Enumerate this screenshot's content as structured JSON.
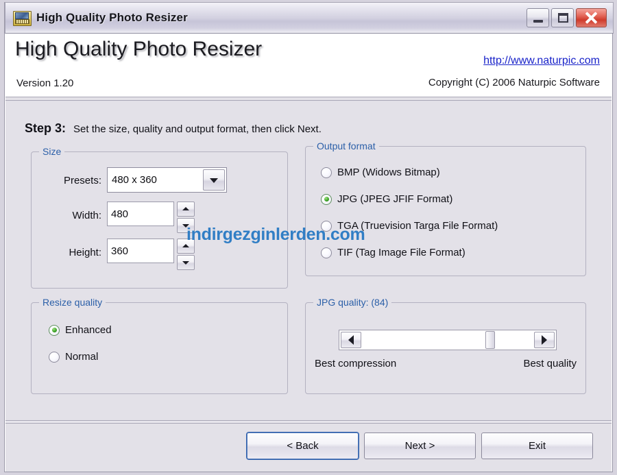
{
  "window": {
    "title": "High Quality Photo Resizer",
    "icon": "photo-resizer-icon",
    "buttons": {
      "minimize": "Minimize",
      "maximize": "Maximize",
      "close": "Close"
    }
  },
  "header": {
    "product_title": "High Quality Photo Resizer",
    "version": "Version 1.20",
    "link": "http://www.naturpic.com",
    "copyright": "Copyright (C) 2006 Naturpic Software"
  },
  "step": {
    "label": "Step 3:",
    "text": "Set the size, quality and output format, then click Next."
  },
  "size": {
    "legend": "Size",
    "presets_label": "Presets:",
    "presets_value": "480 x 360",
    "width_label": "Width:",
    "width_value": "480",
    "height_label": "Height:",
    "height_value": "360"
  },
  "output_format": {
    "legend": "Output format",
    "options": [
      {
        "label": "BMP (Widows Bitmap)",
        "checked": false
      },
      {
        "label": "JPG (JPEG JFIF Format)",
        "checked": true
      },
      {
        "label": "TGA (Truevision Targa File Format)",
        "checked": false
      },
      {
        "label": "TIF (Tag Image File Format)",
        "checked": false
      }
    ]
  },
  "resize_quality": {
    "legend": "Resize quality",
    "options": [
      {
        "label": "Enhanced",
        "checked": true
      },
      {
        "label": "Normal",
        "checked": false
      }
    ]
  },
  "jpg_quality": {
    "legend": "JPG quality: (84)",
    "value": 84,
    "min_caption": "Best compression",
    "max_caption": "Best quality",
    "thumb_percent": 75
  },
  "footer": {
    "back": "< Back",
    "next": "Next >",
    "exit": "Exit"
  },
  "watermark": {
    "text": "indirgezginlerden.com"
  },
  "colors": {
    "accent_link": "#1822c9",
    "legend_blue": "#2b5fa8",
    "radio_green": "#39a024",
    "close_red": "#cf3b2c",
    "watermark_blue": "#2a7bc4",
    "body_bg": "#e3e1e8"
  }
}
